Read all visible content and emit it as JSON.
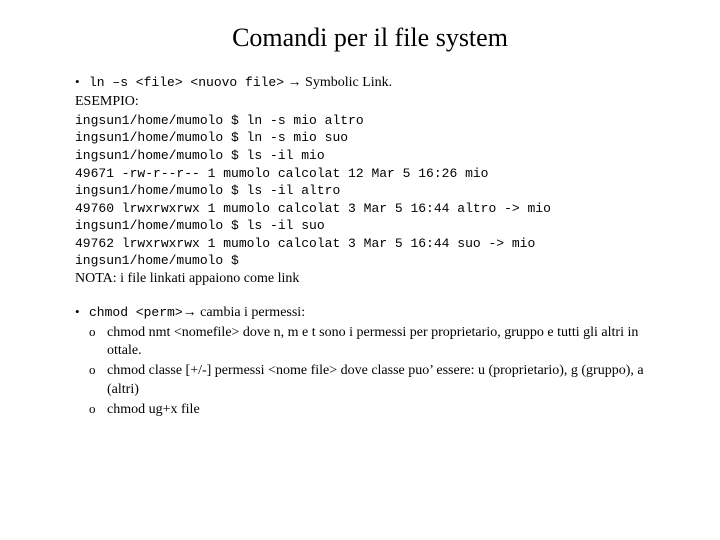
{
  "title": "Comandi per il file system",
  "ln": {
    "cmd": "ln –s <file> <nuovo file>",
    "arrow": " → ",
    "desc": "Symbolic Link.",
    "esempio_label": "ESEMPIO:",
    "terminal": "ingsun1/home/mumolo $ ln -s mio altro\ningsun1/home/mumolo $ ln -s mio suo\ningsun1/home/mumolo $ ls -il mio\n49671 -rw-r--r-- 1 mumolo calcolat 12 Mar 5 16:26 mio\ningsun1/home/mumolo $ ls -il altro\n49760 lrwxrwxrwx 1 mumolo calcolat 3 Mar 5 16:44 altro -> mio\ningsun1/home/mumolo $ ls -il suo\n49762 lrwxrwxrwx 1 mumolo calcolat 3 Mar 5 16:44 suo -> mio\ningsun1/home/mumolo $",
    "nota": "NOTA: i file linkati appaiono come link"
  },
  "chmod": {
    "cmd": "chmod      <perm>",
    "arrow": "→ ",
    "desc": "cambia i permessi:",
    "subs": [
      "chmod nmt <nomefile> dove n, m e t sono i permessi per proprietario, gruppo e tutti gli altri in ottale.",
      "chmod classe [+/-] permessi <nome file> dove classe puo’ essere: u (proprietario), g (gruppo), a (altri)",
      "chmod ug+x file"
    ]
  }
}
